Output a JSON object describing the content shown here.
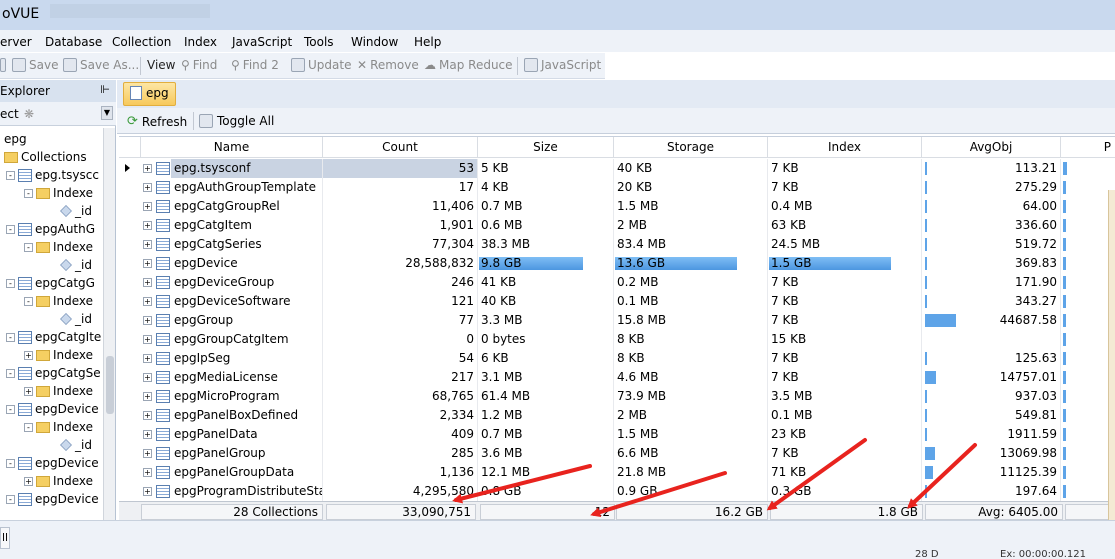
{
  "window": {
    "title": "oVUE"
  },
  "menu": [
    "erver",
    "Database",
    "Collection",
    "Index",
    "JavaScript",
    "Tools",
    "Window",
    "Help"
  ],
  "toolbar": {
    "save": "Save",
    "save_as": "Save As...",
    "view": "View",
    "find": "Find",
    "find2": "Find 2",
    "update": "Update",
    "remove": "Remove",
    "map_reduce": "Map Reduce",
    "javascript": "JavaScript"
  },
  "explorer": {
    "title": "Explorer",
    "connect": "ect",
    "tree": {
      "db": "epg",
      "collections": "Collections",
      "items": [
        "epg.tsyscc",
        "Indexe",
        "_id",
        "epgAuthG",
        "Indexe",
        "_id",
        "epgCatgG",
        "Indexe",
        "_id",
        "epgCatgIte",
        "Indexe",
        "epgCatgSe",
        "Indexe",
        "epgDevice",
        "Indexe",
        "_id",
        "epgDevice",
        "Indexe",
        "epgDevice"
      ]
    }
  },
  "tab": {
    "label": "epg"
  },
  "subtoolbar": {
    "refresh": "Refresh",
    "toggle_all": "Toggle All"
  },
  "grid": {
    "columns": [
      "Name",
      "Count",
      "Size",
      "Storage",
      "Index",
      "AvgObj",
      "P"
    ],
    "rows": [
      {
        "name": "epg.tsysconf",
        "count": "53",
        "size": "5 KB",
        "storage": "40 KB",
        "index": "7 KB",
        "avgobj": "113.21",
        "pad": 0.01
      },
      {
        "name": "epgAuthGroupTemplate",
        "count": "17",
        "size": "4 KB",
        "storage": "20 KB",
        "index": "7 KB",
        "avgobj": "275.29",
        "pad": 0.01
      },
      {
        "name": "epgCatgGroupRel",
        "count": "11,406",
        "size": "0.7 MB",
        "storage": "1.5 MB",
        "index": "0.4 MB",
        "avgobj": "64.00",
        "pad": 0.01
      },
      {
        "name": "epgCatgItem",
        "count": "1,901",
        "size": "0.6 MB",
        "storage": "2 MB",
        "index": "63 KB",
        "avgobj": "336.60",
        "pad": 0.01
      },
      {
        "name": "epgCatgSeries",
        "count": "77,304",
        "size": "38.3 MB",
        "storage": "83.4 MB",
        "index": "24.5 MB",
        "avgobj": "519.72",
        "pad": 0.01
      },
      {
        "name": "epgDevice",
        "count": "28,588,832",
        "size": "9.8 GB",
        "storage": "13.6 GB",
        "index": "1.5 GB",
        "avgobj": "369.83",
        "pad": 0.01
      },
      {
        "name": "epgDeviceGroup",
        "count": "246",
        "size": "41 KB",
        "storage": "0.2 MB",
        "index": "7 KB",
        "avgobj": "171.90",
        "pad": 0.01
      },
      {
        "name": "epgDeviceSoftware",
        "count": "121",
        "size": "40 KB",
        "storage": "0.1 MB",
        "index": "7 KB",
        "avgobj": "343.27",
        "pad": 0.01
      },
      {
        "name": "epgGroup",
        "count": "77",
        "size": "3.3 MB",
        "storage": "15.8 MB",
        "index": "7 KB",
        "avgobj": "44687.58",
        "pad": 0.23
      },
      {
        "name": "epgGroupCatgItem",
        "count": "0",
        "size": "0 bytes",
        "storage": "8 KB",
        "index": "15 KB",
        "avgobj": "",
        "pad": 0.0
      },
      {
        "name": "epgIpSeg",
        "count": "54",
        "size": "6 KB",
        "storage": "8 KB",
        "index": "7 KB",
        "avgobj": "125.63",
        "pad": 0.01
      },
      {
        "name": "epgMediaLicense",
        "count": "217",
        "size": "3.1 MB",
        "storage": "4.6 MB",
        "index": "7 KB",
        "avgobj": "14757.01",
        "pad": 0.08
      },
      {
        "name": "epgMicroProgram",
        "count": "68,765",
        "size": "61.4 MB",
        "storage": "73.9 MB",
        "index": "3.5 MB",
        "avgobj": "937.03",
        "pad": 0.01
      },
      {
        "name": "epgPanelBoxDefined",
        "count": "2,334",
        "size": "1.2 MB",
        "storage": "2 MB",
        "index": "0.1 MB",
        "avgobj": "549.81",
        "pad": 0.01
      },
      {
        "name": "epgPanelData",
        "count": "409",
        "size": "0.7 MB",
        "storage": "1.5 MB",
        "index": "23 KB",
        "avgobj": "1911.59",
        "pad": 0.01
      },
      {
        "name": "epgPanelGroup",
        "count": "285",
        "size": "3.6 MB",
        "storage": "6.6 MB",
        "index": "7 KB",
        "avgobj": "13069.98",
        "pad": 0.07
      },
      {
        "name": "epgPanelGroupData",
        "count": "1,136",
        "size": "12.1 MB",
        "storage": "21.8 MB",
        "index": "71 KB",
        "avgobj": "11125.39",
        "pad": 0.06
      },
      {
        "name": "epgProgramDistributeSta...",
        "count": "4,295,580",
        "size": "0.8 GB",
        "storage": "0.9 GB",
        "index": "0.3 GB",
        "avgobj": "197.64",
        "pad": 0.01
      }
    ],
    "highlight": {
      "row": 5,
      "size_frac": 1.0,
      "storage_frac": 1.0,
      "index_frac": 1.0
    },
    "footer": {
      "collections": "28 Collections",
      "count": "33,090,751",
      "size": "12",
      "storage": "16.2 GB",
      "index": "1.8 GB",
      "avg": "Avg: 6405.00"
    }
  },
  "status": {
    "a": "28 D",
    "b": "Ex: 00:00:00.121"
  },
  "colors": {
    "accent_bar": "#5ea4e8",
    "selection": "#c9d3e2",
    "tab": "#f7c95c",
    "annotation": "#e8231e"
  }
}
